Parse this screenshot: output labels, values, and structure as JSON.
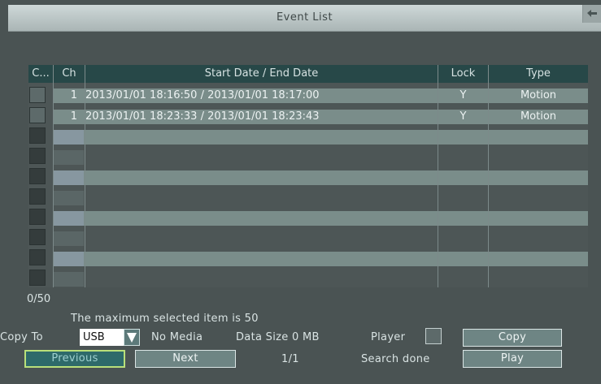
{
  "window": {
    "title": "Event List"
  },
  "table": {
    "headers": {
      "check": "C...",
      "ch": "Ch",
      "dates": "Start Date / End Date",
      "lock": "Lock",
      "type": "Type"
    },
    "rows": [
      {
        "ch": "1",
        "dates": "2013/01/01 18:16:50  /  2013/01/01 18:17:00",
        "lock": "Y",
        "type": "Motion"
      },
      {
        "ch": "1",
        "dates": "2013/01/01 18:23:33  /  2013/01/01 18:23:43",
        "lock": "Y",
        "type": "Motion"
      }
    ]
  },
  "footer": {
    "count": "0/50",
    "max_text": "The maximum selected item is 50",
    "copy_to_label": "Copy To",
    "copy_target": "USB",
    "media_status": "No Media",
    "data_size": "Data Size 0 MB",
    "player_label": "Player",
    "copy_button": "Copy",
    "previous_button": "Previous",
    "next_button": "Next",
    "page": "1/1",
    "search_status": "Search done",
    "play_button": "Play"
  }
}
